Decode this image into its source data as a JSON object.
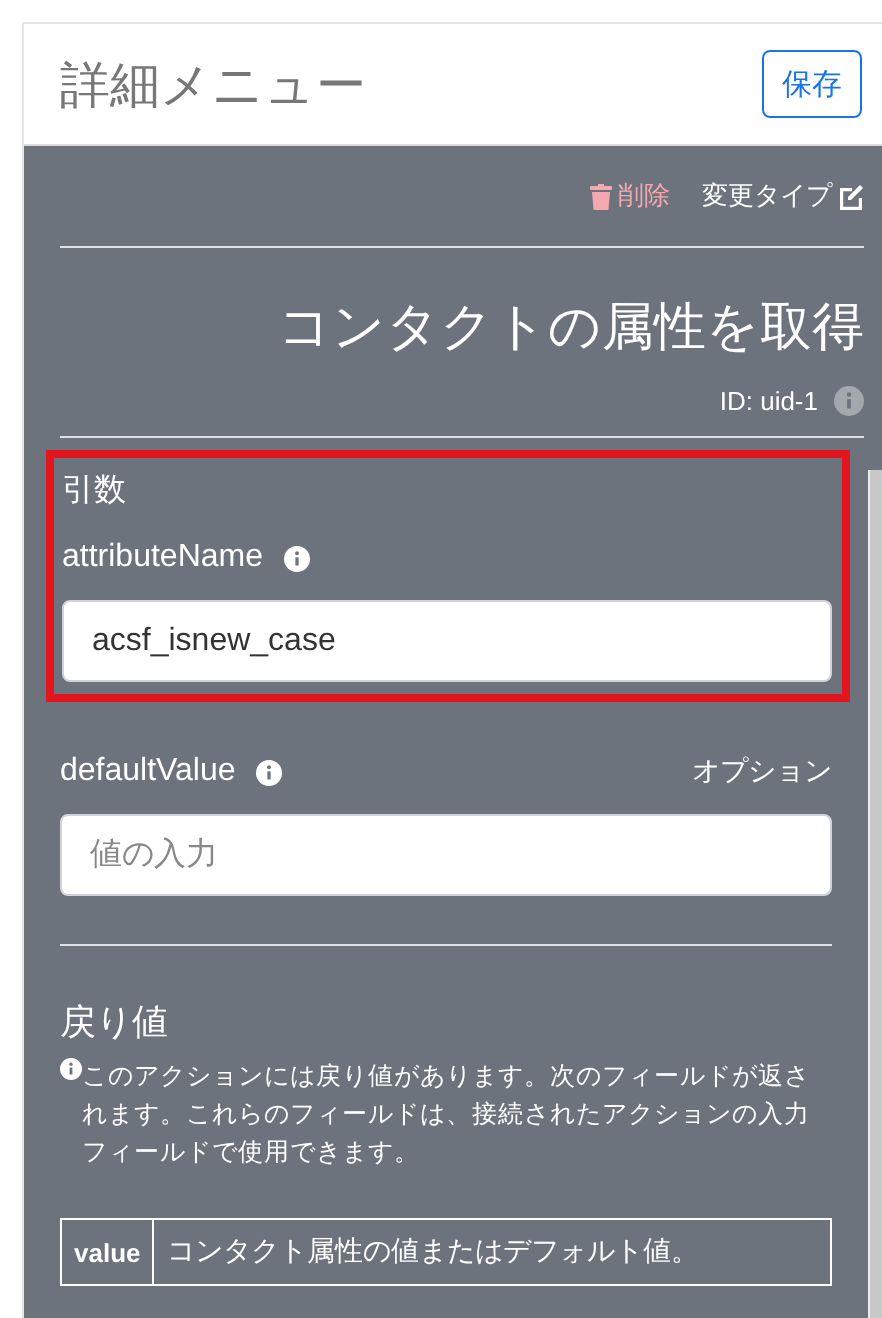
{
  "header": {
    "title": "詳細メニュー",
    "save_button": "保存"
  },
  "actions": {
    "delete": "削除",
    "change_type": "変更タイプ"
  },
  "action": {
    "title": "コンタクトの属性を取得",
    "id": "ID: uid-1"
  },
  "arguments": {
    "heading": "引数",
    "highlighted": true,
    "fields": [
      {
        "name": "attributeName",
        "value": "acsf_isnew_case"
      },
      {
        "name": "defaultValue",
        "optional_label": "オプション",
        "placeholder": "値の入力"
      }
    ]
  },
  "return_value": {
    "heading": "戻り値",
    "description": "このアクションには戻り値があります。次のフィールドが返されます。これらのフィールドは、接続されたアクションの入力フィールドで使用できます。",
    "rows": [
      {
        "name": "value",
        "description": "コンタクト属性の値またはデフォルト値。"
      }
    ]
  }
}
